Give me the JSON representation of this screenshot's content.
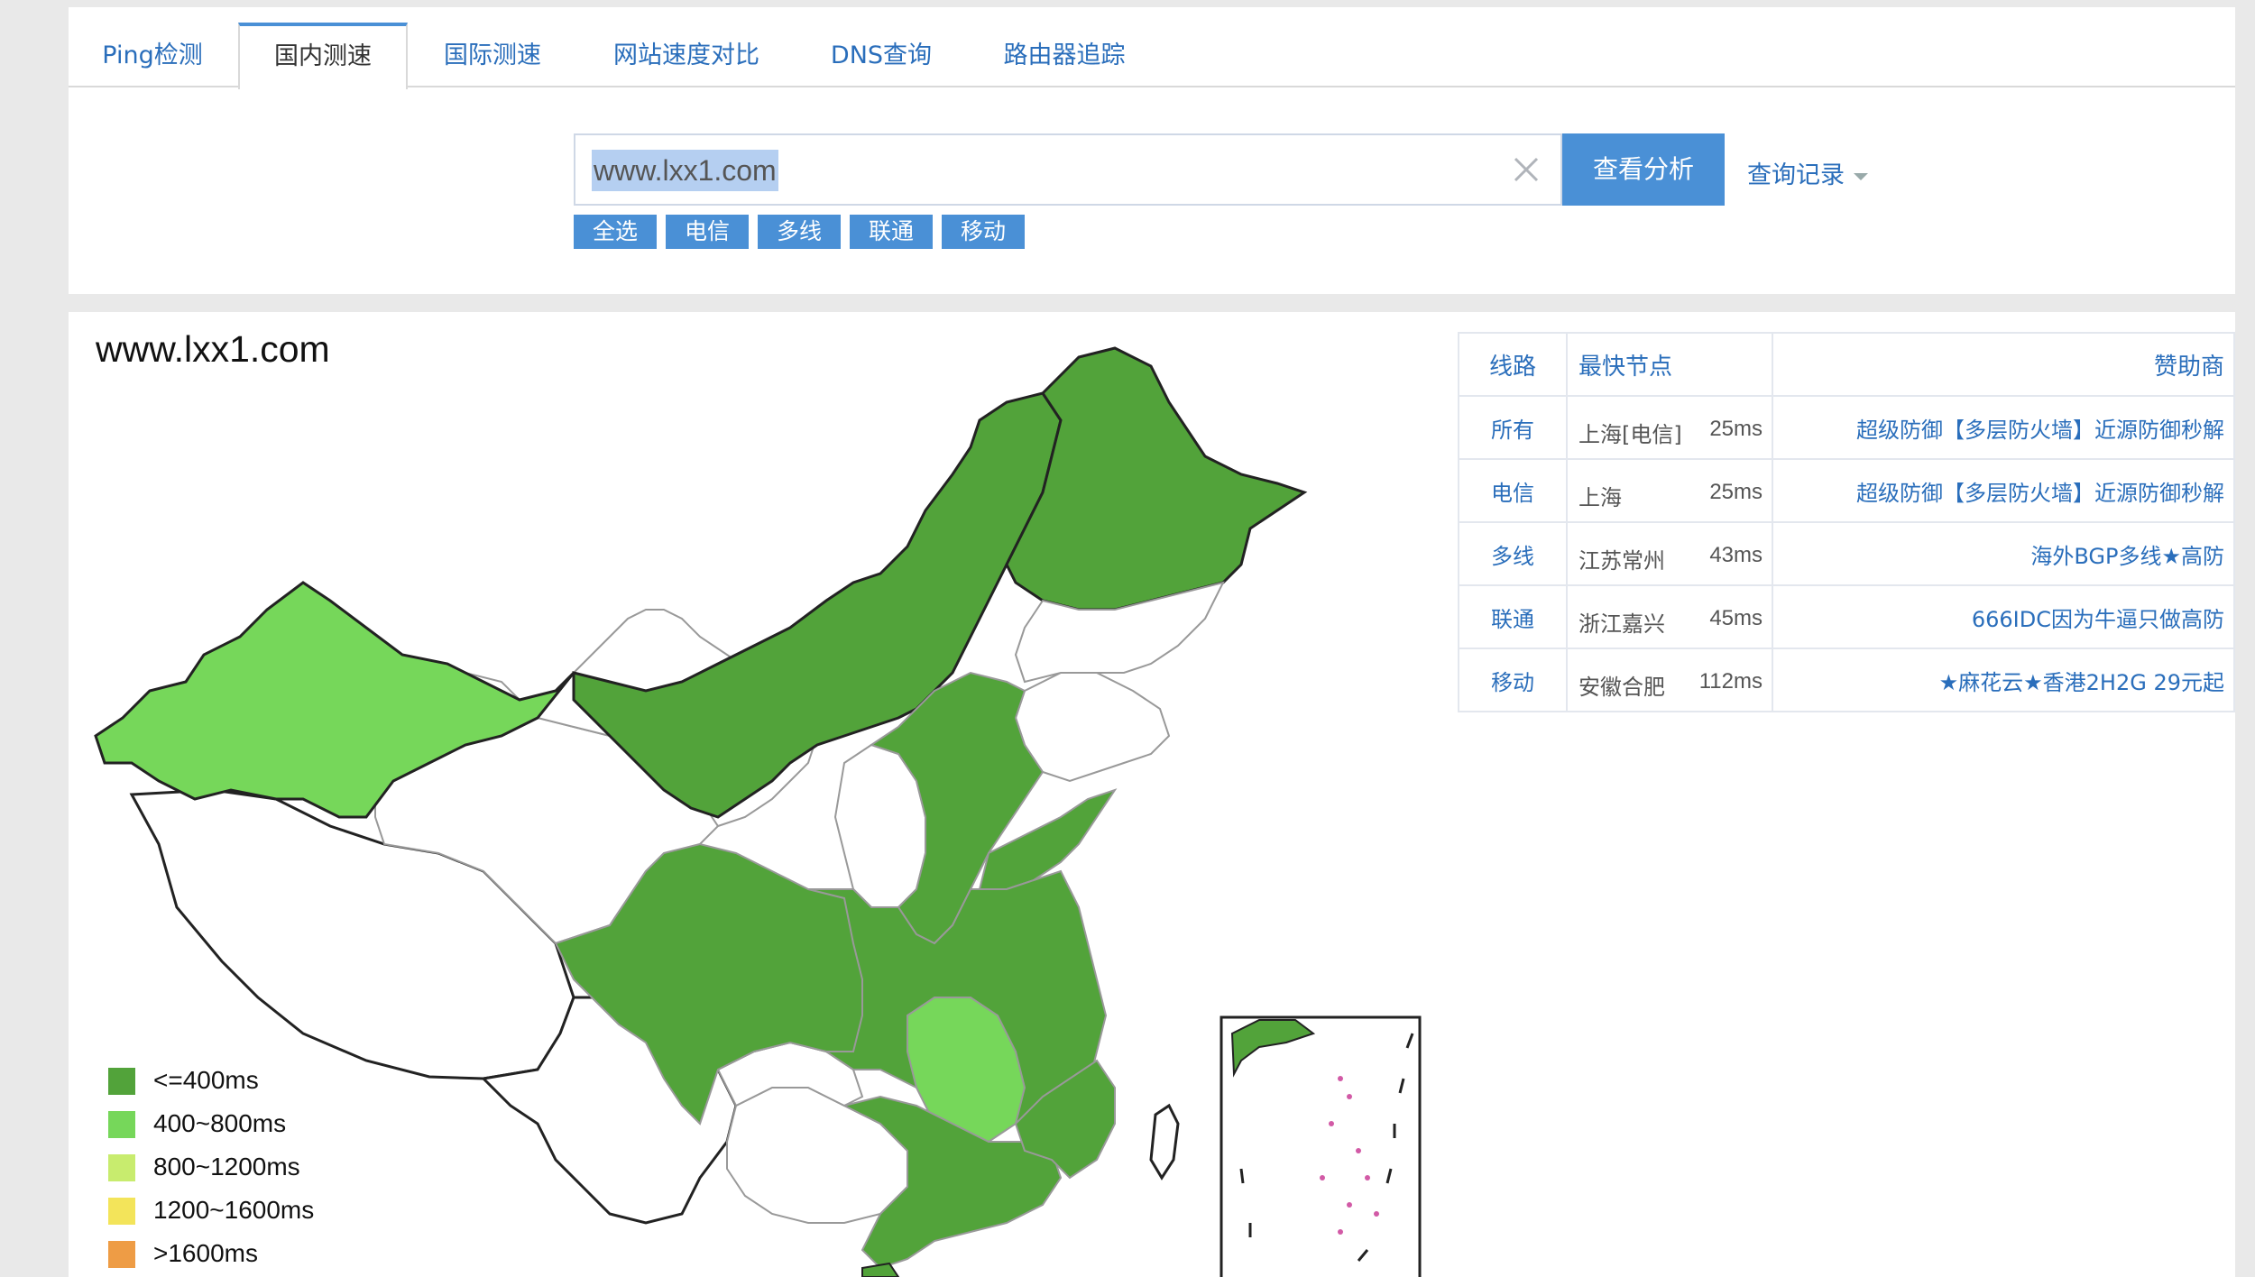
{
  "tabs": [
    {
      "label": "Ping检测",
      "active": false
    },
    {
      "label": "国内测速",
      "active": true
    },
    {
      "label": "国际测速",
      "active": false
    },
    {
      "label": "网站速度对比",
      "active": false
    },
    {
      "label": "DNS查询",
      "active": false
    },
    {
      "label": "路由器追踪",
      "active": false
    }
  ],
  "search": {
    "value": "www.lxx1.com",
    "analyze_label": "查看分析",
    "history_label": "查询记录"
  },
  "filters": [
    "全选",
    "电信",
    "多线",
    "联通",
    "移动"
  ],
  "result": {
    "title": "www.lxx1.com",
    "legend": [
      {
        "label": "<=400ms",
        "color": "#52a33a"
      },
      {
        "label": "400~800ms",
        "color": "#76d75a"
      },
      {
        "label": "800~1200ms",
        "color": "#c8ec6e"
      },
      {
        "label": "1200~1600ms",
        "color": "#f3e45a"
      },
      {
        "label": ">1600ms",
        "color": "#ee9c45"
      }
    ],
    "table": {
      "headers": {
        "line": "线路",
        "node": "最快节点",
        "sponsor": "赞助商"
      },
      "rows": [
        {
          "line": "所有",
          "node": "上海[电信]",
          "ms": "25ms",
          "sponsor": "超级防御【多层防火墙】近源防御秒解"
        },
        {
          "line": "电信",
          "node": "上海",
          "ms": "25ms",
          "sponsor": "超级防御【多层防火墙】近源防御秒解"
        },
        {
          "line": "多线",
          "node": "江苏常州",
          "ms": "43ms",
          "sponsor": "海外BGP多线★高防"
        },
        {
          "line": "联通",
          "node": "浙江嘉兴",
          "ms": "45ms",
          "sponsor": "666IDC因为牛逼只做高防"
        },
        {
          "line": "移动",
          "node": "安徽合肥",
          "ms": "112ms",
          "sponsor": "★麻花云★香港2H2G 29元起"
        }
      ]
    }
  },
  "colors": {
    "accent": "#4a90d6",
    "link": "#2a6ebb",
    "fast": "#52a33a",
    "medium": "#76d75a"
  }
}
